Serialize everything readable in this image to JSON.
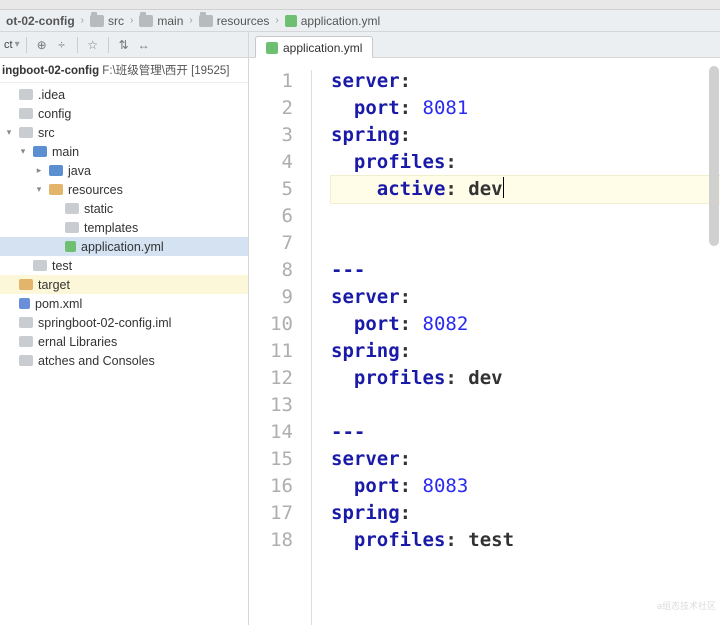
{
  "breadcrumb": {
    "items": [
      {
        "label": "ot-02-config"
      },
      {
        "label": "src"
      },
      {
        "label": "main"
      },
      {
        "label": "resources"
      },
      {
        "label": "application.yml"
      }
    ]
  },
  "toolbar": {
    "left_label": "ct",
    "tools": [
      "⊕",
      "÷",
      "☆",
      "⇅",
      "↔"
    ]
  },
  "editor_tab": {
    "label": "application.yml"
  },
  "sidebar": {
    "header_bold": "ingboot-02-config",
    "header_rest": " F:\\班级管理\\西开 [19525]",
    "tree": [
      {
        "label": ".idea",
        "indent": 0,
        "icon": "folder"
      },
      {
        "label": "config",
        "indent": 0,
        "icon": "folder"
      },
      {
        "label": "src",
        "indent": 0,
        "icon": "folder",
        "arrow": "▾"
      },
      {
        "label": "main",
        "indent": 1,
        "icon": "folder-blue",
        "arrow": "▾"
      },
      {
        "label": "java",
        "indent": 2,
        "icon": "folder-blue",
        "arrow": "▸"
      },
      {
        "label": "resources",
        "indent": 2,
        "icon": "folder-orange",
        "arrow": "▾"
      },
      {
        "label": "static",
        "indent": 3,
        "icon": "folder"
      },
      {
        "label": "templates",
        "indent": 3,
        "icon": "folder"
      },
      {
        "label": "application.yml",
        "indent": 3,
        "icon": "yml",
        "selected": true
      },
      {
        "label": "test",
        "indent": 1,
        "icon": "folder"
      },
      {
        "label": "target",
        "indent": 0,
        "icon": "folder-orange",
        "target": true
      },
      {
        "label": "pom.xml",
        "indent": 0,
        "icon": "xml"
      },
      {
        "label": "springboot-02-config.iml",
        "indent": 0,
        "icon": "file"
      },
      {
        "label": "ernal Libraries",
        "indent": 0,
        "icon": "lib"
      },
      {
        "label": "atches and Consoles",
        "indent": 0,
        "icon": "scratch"
      }
    ]
  },
  "code": {
    "line_numbers": [
      "1",
      "2",
      "3",
      "4",
      "5",
      "6",
      "7",
      "8",
      "9",
      "10",
      "11",
      "12",
      "13",
      "14",
      "15",
      "16",
      "17",
      "18"
    ],
    "lines": [
      {
        "tokens": [
          {
            "cls": "kw",
            "t": "server"
          },
          {
            "cls": "txt",
            "t": ":"
          }
        ],
        "indent": 0
      },
      {
        "tokens": [
          {
            "cls": "kw",
            "t": "port"
          },
          {
            "cls": "txt",
            "t": ": "
          },
          {
            "cls": "num",
            "t": "8081"
          }
        ],
        "indent": 1
      },
      {
        "tokens": [
          {
            "cls": "kw",
            "t": "spring"
          },
          {
            "cls": "txt",
            "t": ":"
          }
        ],
        "indent": 0
      },
      {
        "tokens": [
          {
            "cls": "kw",
            "t": "profiles"
          },
          {
            "cls": "txt",
            "t": ":"
          }
        ],
        "indent": 1
      },
      {
        "tokens": [
          {
            "cls": "kw",
            "t": "active"
          },
          {
            "cls": "txt",
            "t": ": dev"
          }
        ],
        "indent": 2,
        "current": true,
        "caret": true
      },
      {
        "tokens": [],
        "indent": 0
      },
      {
        "tokens": [],
        "indent": 0
      },
      {
        "tokens": [
          {
            "cls": "kw",
            "t": "---"
          }
        ],
        "indent": 0
      },
      {
        "tokens": [
          {
            "cls": "kw",
            "t": "server"
          },
          {
            "cls": "txt",
            "t": ":"
          }
        ],
        "indent": 0
      },
      {
        "tokens": [
          {
            "cls": "kw",
            "t": "port"
          },
          {
            "cls": "txt",
            "t": ": "
          },
          {
            "cls": "num",
            "t": "8082"
          }
        ],
        "indent": 1
      },
      {
        "tokens": [
          {
            "cls": "kw",
            "t": "spring"
          },
          {
            "cls": "txt",
            "t": ":"
          }
        ],
        "indent": 0
      },
      {
        "tokens": [
          {
            "cls": "kw",
            "t": "profiles"
          },
          {
            "cls": "txt",
            "t": ": dev"
          }
        ],
        "indent": 1
      },
      {
        "tokens": [],
        "indent": 0
      },
      {
        "tokens": [
          {
            "cls": "kw",
            "t": "---"
          }
        ],
        "indent": 0
      },
      {
        "tokens": [
          {
            "cls": "kw",
            "t": "server"
          },
          {
            "cls": "txt",
            "t": ":"
          }
        ],
        "indent": 0
      },
      {
        "tokens": [
          {
            "cls": "kw",
            "t": "port"
          },
          {
            "cls": "txt",
            "t": ": "
          },
          {
            "cls": "num",
            "t": "8083"
          }
        ],
        "indent": 1
      },
      {
        "tokens": [
          {
            "cls": "kw",
            "t": "spring"
          },
          {
            "cls": "txt",
            "t": ":"
          }
        ],
        "indent": 0
      },
      {
        "tokens": [
          {
            "cls": "kw",
            "t": "profiles"
          },
          {
            "cls": "txt",
            "t": ": test"
          }
        ],
        "indent": 1
      }
    ]
  },
  "watermark": "a组态技术社区"
}
